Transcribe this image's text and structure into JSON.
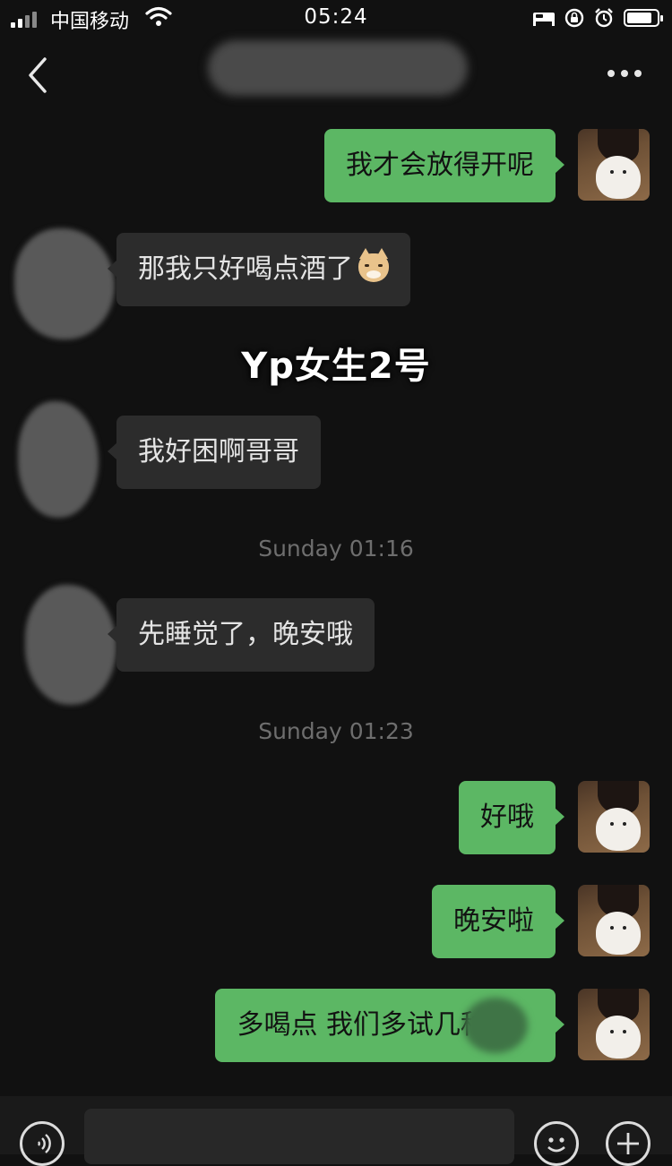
{
  "status_bar": {
    "carrier": "中国移动",
    "time": "05:24",
    "icons": [
      "signal-bars-icon",
      "wifi-icon",
      "bed-icon",
      "rotation-lock-icon",
      "alarm-icon",
      "battery-icon"
    ],
    "battery_level": 0.85
  },
  "nav": {
    "back_icon": "chevron-left-icon",
    "more_icon": "ellipsis-icon"
  },
  "overlay_label": "Yp女生2号",
  "messages": [
    {
      "sender": "me",
      "text": "我才会放得开呢"
    },
    {
      "sender": "other",
      "text": "那我只好喝点酒了",
      "emoji": "smiling-cat-emoji"
    },
    {
      "sender": "other",
      "text": "我好困啊哥哥"
    },
    {
      "sender": "other",
      "text": "先睡觉了，晚安哦"
    },
    {
      "sender": "me",
      "text": "好哦"
    },
    {
      "sender": "me",
      "text": "晚安啦"
    },
    {
      "sender": "me",
      "text": "多喝点 我们多试几种"
    }
  ],
  "timestamps": [
    "Sunday 01:16",
    "Sunday 01:23"
  ],
  "input_bar": {
    "voice_icon": "voice-icon",
    "emoji_icon": "smiley-icon",
    "plus_icon": "plus-icon"
  },
  "colors": {
    "background": "#111111",
    "my_bubble": "#5cb764",
    "other_bubble": "#2c2c2c",
    "timestamp": "#6e6e6e"
  }
}
